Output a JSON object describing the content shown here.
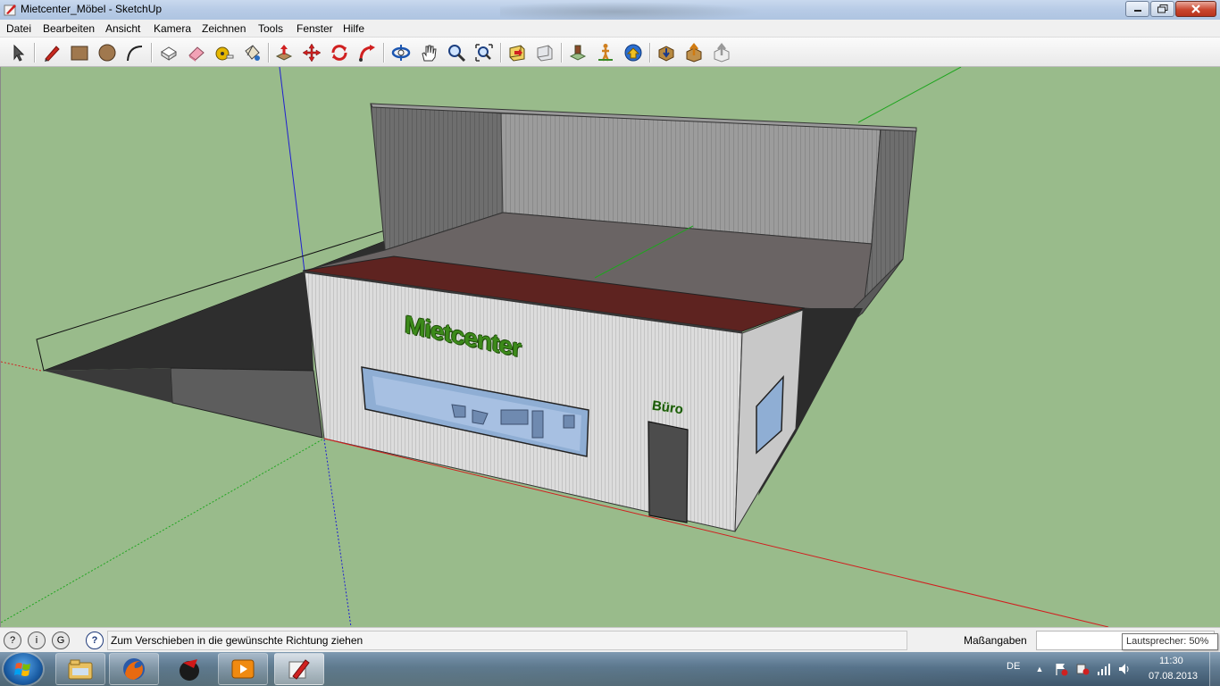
{
  "window": {
    "title": "Mietcenter_Möbel - SketchUp",
    "icon": "sketchup-app-icon"
  },
  "menu": [
    "Datei",
    "Bearbeiten",
    "Ansicht",
    "Kamera",
    "Zeichnen",
    "Tools",
    "Fenster",
    "Hilfe"
  ],
  "toolbar": {
    "tools": [
      "select-icon",
      "pencil-line-icon",
      "rectangle-icon",
      "circle-icon",
      "arc-icon",
      "make-component-icon",
      "eraser-icon",
      "tape-measure-icon",
      "paint-bucket-icon",
      "push-pull-icon",
      "move-icon",
      "rotate-icon",
      "follow-me-icon",
      "orbit-icon",
      "pan-icon",
      "zoom-icon",
      "zoom-extents-icon",
      "previous-view-icon",
      "next-view-icon",
      "position-camera-icon",
      "walk-icon",
      "look-around-icon",
      "get-models-icon",
      "share-model-icon",
      "share-component-icon"
    ]
  },
  "model": {
    "sign_main": "Mietcenter",
    "sign_office": "Büro"
  },
  "status": {
    "message": "Zum Verschieben in die gewünschte Richtung ziehen",
    "measure_label": "Maßangaben",
    "measure_value": "",
    "tooltip": "Lautsprecher: 50%"
  },
  "taskbar": {
    "apps": [
      "explorer-icon",
      "firefox-icon",
      "pin-app-icon",
      "media-player-icon",
      "sketchup-icon"
    ],
    "language": "DE",
    "time": "11:30",
    "date": "07.08.2013"
  },
  "colors": {
    "ground": "#99bb8b",
    "roof": "#5e2320",
    "sign_green": "#2f7a10",
    "axis_red": "#d11f1f",
    "axis_green": "#1fa51f",
    "axis_blue": "#1f1fd1"
  }
}
